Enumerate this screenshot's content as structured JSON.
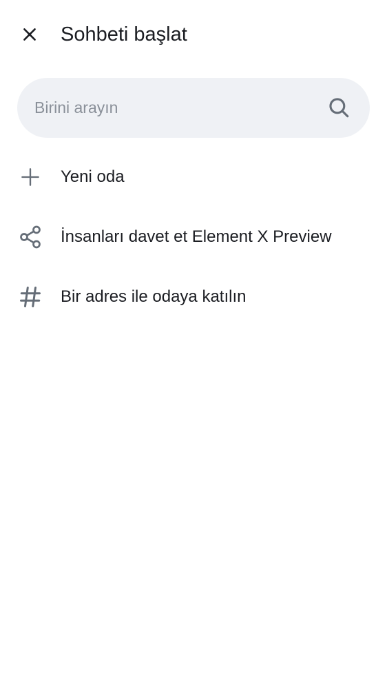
{
  "header": {
    "title": "Sohbeti başlat",
    "close_icon": "close-icon"
  },
  "search": {
    "placeholder": "Birini arayın",
    "value": "",
    "icon": "search-icon"
  },
  "menu": {
    "items": [
      {
        "label": "Yeni oda",
        "icon": "plus-icon"
      },
      {
        "label": "İnsanları davet et Element X Preview",
        "icon": "share-icon"
      },
      {
        "label": "Bir adres ile odaya katılın",
        "icon": "hash-icon"
      }
    ]
  },
  "colors": {
    "text": "#1b1d22",
    "icon": "#656d77",
    "search_background": "#eff1f5",
    "placeholder": "#8a9099",
    "background": "#ffffff"
  }
}
